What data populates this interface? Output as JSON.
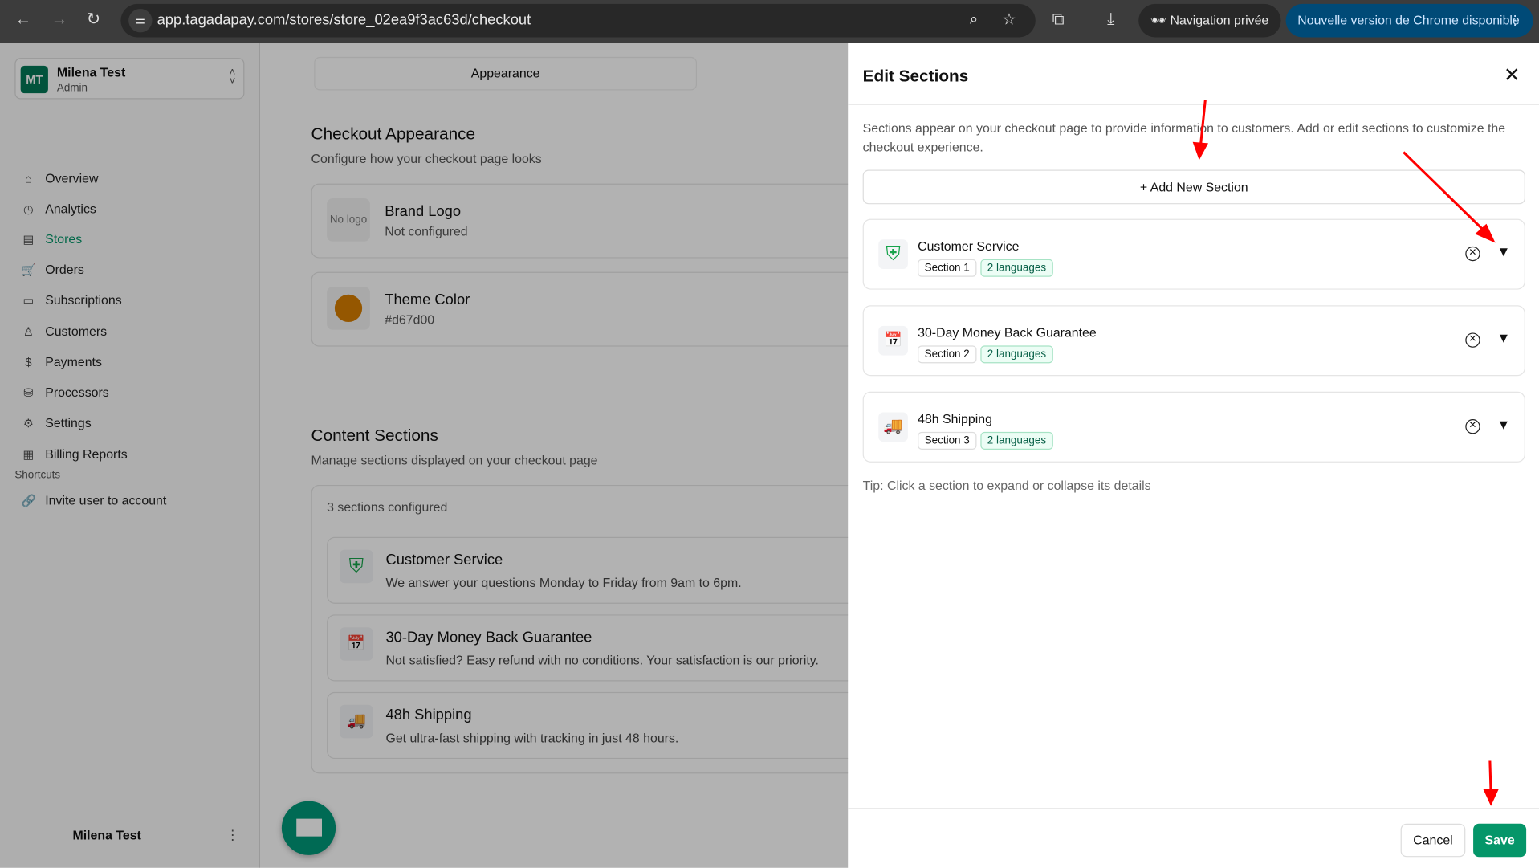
{
  "browser": {
    "url": "app.tagadapay.com/stores/store_02ea9f3ac63d/checkout",
    "incognito_label": "Navigation privée",
    "update_label": "Nouvelle version de Chrome disponible"
  },
  "account": {
    "initials": "MT",
    "name": "Milena Test",
    "role": "Admin"
  },
  "sidebar": {
    "items": [
      {
        "label": "Overview",
        "icon": "⌂"
      },
      {
        "label": "Analytics",
        "icon": "◷"
      },
      {
        "label": "Stores",
        "icon": "▤"
      },
      {
        "label": "Orders",
        "icon": "🛒"
      },
      {
        "label": "Subscriptions",
        "icon": "▭"
      },
      {
        "label": "Customers",
        "icon": "♙"
      },
      {
        "label": "Payments",
        "icon": "$"
      },
      {
        "label": "Processors",
        "icon": "⛁"
      },
      {
        "label": "Settings",
        "icon": "⚙"
      },
      {
        "label": "Billing Reports",
        "icon": "▦"
      }
    ],
    "shortcuts_title": "Shortcuts",
    "shortcuts": [
      {
        "label": "Invite user to account"
      }
    ],
    "footer_name": "Milena Test"
  },
  "main": {
    "tab": "Appearance",
    "appearance_title": "Checkout Appearance",
    "appearance_sub": "Configure how your checkout page looks",
    "logo_placeholder": "No logo",
    "logo_title": "Brand Logo",
    "logo_status": "Not configured",
    "theme_title": "Theme Color",
    "theme_value": "#d67d00",
    "content_title": "Content Sections",
    "content_sub": "Manage sections displayed on your checkout page",
    "count": "3 sections configured",
    "sections": [
      {
        "title": "Customer Service",
        "desc": "We answer your questions Monday to Friday from 9am to 6pm."
      },
      {
        "title": "30-Day Money Back Guarantee",
        "desc": "Not satisfied? Easy refund with no conditions. Your satisfaction is our priority."
      },
      {
        "title": "48h Shipping",
        "desc": "Get ultra-fast shipping with tracking in just 48 hours."
      }
    ]
  },
  "panel": {
    "title": "Edit Sections",
    "description": "Sections appear on your checkout page to provide information to customers. Add or edit sections to customize the checkout experience.",
    "add_label": "+  Add New Section",
    "sections": [
      {
        "title": "Customer Service",
        "tag": "Section 1",
        "langs": "2 languages"
      },
      {
        "title": "30-Day Money Back Guarantee",
        "tag": "Section 2",
        "langs": "2 languages"
      },
      {
        "title": "48h Shipping",
        "tag": "Section 3",
        "langs": "2 languages"
      }
    ],
    "tip": "Tip: Click a section to expand or collapse its details",
    "cancel": "Cancel",
    "save": "Save"
  },
  "colors": {
    "accent": "#059669",
    "theme": "#d67d00",
    "annotation": "#ff0000"
  }
}
